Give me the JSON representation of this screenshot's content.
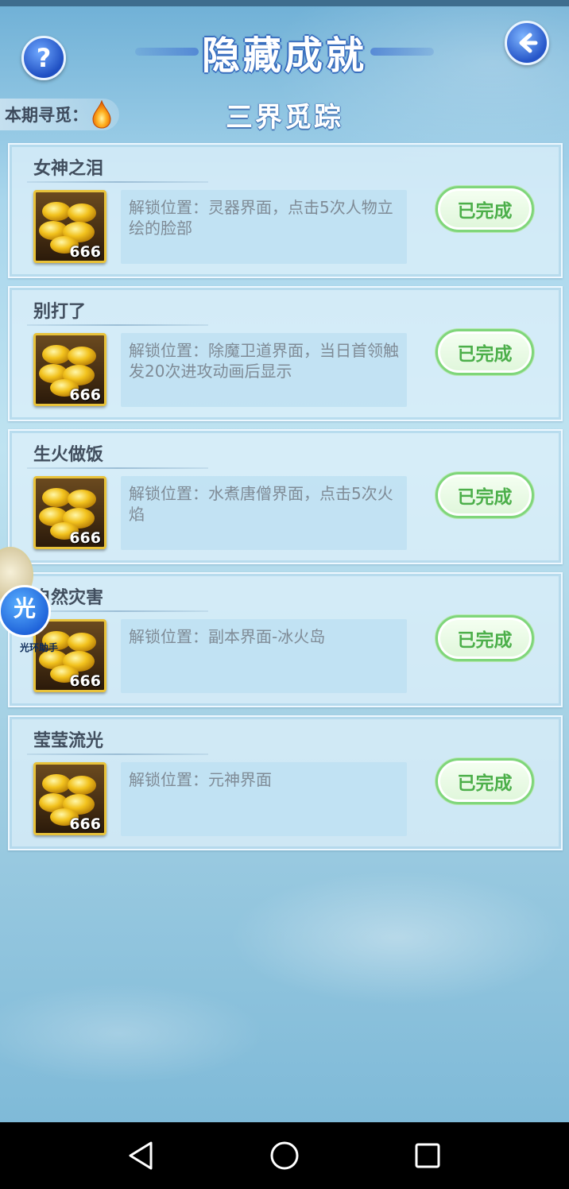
{
  "header": {
    "title": "隐藏成就",
    "help_icon": "question-icon",
    "back_icon": "back-arrow-icon",
    "period_label": "本期寻觅：",
    "period_icon": "flame-drop-icon",
    "subtitle": "三界觅踪"
  },
  "achievements": [
    {
      "name": "女神之泪",
      "reward_count": "666",
      "description": "解锁位置：灵器界面，点击5次人物立绘的脸部",
      "status": "已完成"
    },
    {
      "name": "别打了",
      "reward_count": "666",
      "description": "解锁位置：除魔卫道界面，当日首领触发20次进攻动画后显示",
      "status": "已完成"
    },
    {
      "name": "生火做饭",
      "reward_count": "666",
      "description": "解锁位置：水煮唐僧界面，点击5次火焰",
      "status": "已完成"
    },
    {
      "name": "自然灾害",
      "reward_count": "666",
      "description": "解锁位置：副本界面-冰火岛",
      "status": "已完成"
    },
    {
      "name": "莹莹流光",
      "reward_count": "666",
      "description": "解锁位置：元神界面",
      "status": "已完成"
    }
  ],
  "floating_helper": {
    "glyph": "光",
    "label": "光环助手"
  },
  "system_nav": {
    "back_icon": "triangle-back-icon",
    "home_icon": "circle-home-icon",
    "recents_icon": "square-recents-icon"
  },
  "colors": {
    "status_green": "#4caf4a",
    "reward_border": "#e8c23a",
    "title_outline": "#3a6fbf"
  }
}
